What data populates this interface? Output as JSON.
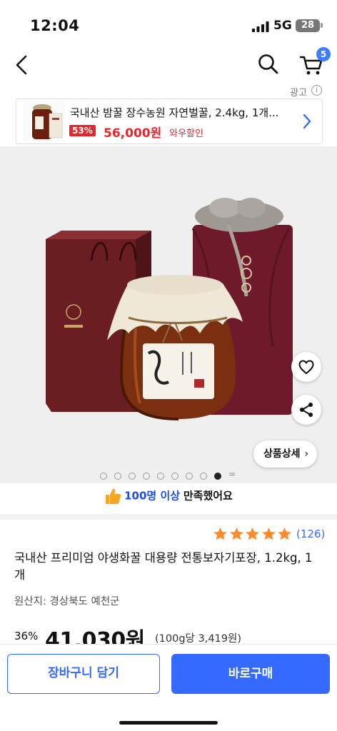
{
  "status": {
    "time": "12:04",
    "network": "5G",
    "battery": "28"
  },
  "nav": {
    "cart_count": "5"
  },
  "ad": {
    "label": "광고",
    "info": "i",
    "title": "국내산 밤꿀 장수농원 자연벌꿀, 2.4kg, 1개...",
    "discount": "53%",
    "price": "56,000원",
    "deal": "와우할인"
  },
  "gallery": {
    "detail_button": "상품상세",
    "more": "=",
    "dot_count": 9,
    "active_index": 8
  },
  "satisfaction": {
    "strong": "100명 이상",
    "rest": "만족했어요"
  },
  "rating": {
    "stars": 5,
    "count": "(126)"
  },
  "product": {
    "title": "국내산 프리미엄 야생화꿀 대용량 전통보자기포장, 1.2kg, 1개",
    "origin": "원산지: 경상북도 예천군",
    "discount": "36%",
    "price": "41,030원",
    "unit_price": "(100g당 3,419원)"
  },
  "actions": {
    "cart": "장바구니 담기",
    "buy": "바로구매"
  },
  "colors": {
    "accent": "#346aff",
    "sale": "#e5262c",
    "star": "#ff8a2b"
  },
  "icons": [
    "back-icon",
    "search-icon",
    "cart-icon",
    "info-icon",
    "chevron-right-icon",
    "heart-icon",
    "share-icon",
    "thumbs-up-icon",
    "star-icon"
  ]
}
